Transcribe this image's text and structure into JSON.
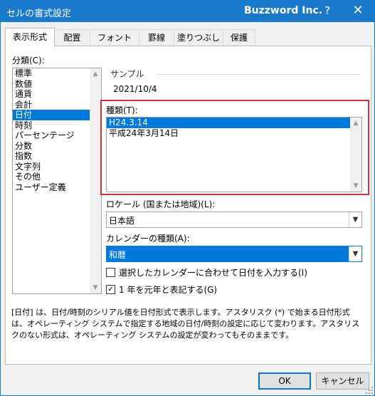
{
  "title": "セルの書式設定",
  "app_name": "Buzzword Inc.",
  "help_glyph": "?",
  "close_glyph": "✕",
  "tabs": [
    {
      "label": "表示形式"
    },
    {
      "label": "配置"
    },
    {
      "label": "フォント"
    },
    {
      "label": "罫線"
    },
    {
      "label": "塗りつぶし"
    },
    {
      "label": "保護"
    }
  ],
  "category": {
    "label": "分類(C):",
    "items": [
      "標準",
      "数値",
      "通貨",
      "会計",
      "日付",
      "時刻",
      "パーセンテージ",
      "分数",
      "指数",
      "文字列",
      "その他",
      "ユーザー定義"
    ],
    "selected_index": 4
  },
  "sample": {
    "label": "サンプル",
    "value": "2021/10/4"
  },
  "type": {
    "label": "種類(T):",
    "items": [
      "H24.3.14",
      "平成24年3月14日"
    ],
    "selected_index": 0
  },
  "locale": {
    "label": "ロケール (国または地域)(L):",
    "value": "日本語"
  },
  "calendar": {
    "label": "カレンダーの種類(A):",
    "value": "和暦"
  },
  "checkbox_input": {
    "label": "選択したカレンダーに合わせて日付を入力する(I)",
    "checked": false
  },
  "checkbox_gannen": {
    "label": "1 年を元年と表記する(G)",
    "checked": true,
    "check_glyph": "✓"
  },
  "description": "[日付] は、日付/時刻のシリアル値を日付形式で表示します。アスタリスク (*) で始まる日付形式は、オペレーティング システムで指定する地域の日付/時刻の設定に応じて変わります。アスタリスクのない形式は、オペレーティング システムの設定が変わってもそのままです。",
  "buttons": {
    "ok": "OK",
    "cancel": "キャンセル"
  },
  "colors": {
    "titlebar": "#1979ca",
    "selection": "#0078d7",
    "highlight_box": "#d0343a"
  }
}
